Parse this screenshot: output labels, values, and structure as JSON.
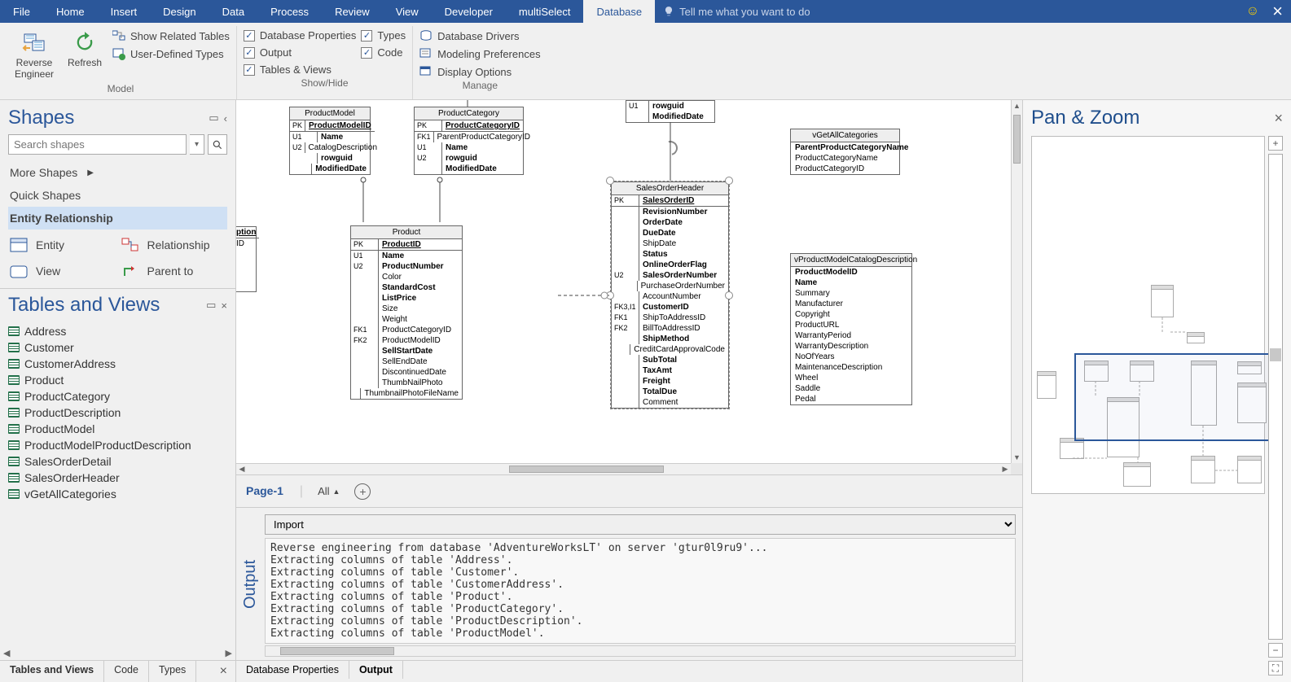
{
  "menubar": {
    "tabs": [
      "File",
      "Home",
      "Insert",
      "Design",
      "Data",
      "Process",
      "Review",
      "View",
      "Developer",
      "multiSelect",
      "Database"
    ],
    "active": "Database",
    "tellme": "Tell me what you want to do"
  },
  "ribbon": {
    "model": {
      "caption": "Model",
      "reverse": "Reverse Engineer",
      "refresh": "Refresh",
      "showrel": "Show Related Tables",
      "udt": "User-Defined Types"
    },
    "showhide": {
      "caption": "Show/Hide",
      "dbprops": "Database Properties",
      "output": "Output",
      "tviews": "Tables & Views",
      "types": "Types",
      "code": "Code"
    },
    "manage": {
      "caption": "Manage",
      "drivers": "Database Drivers",
      "prefs": "Modeling Preferences",
      "display": "Display Options"
    }
  },
  "shapes": {
    "title": "Shapes",
    "search_ph": "Search shapes",
    "more": "More Shapes",
    "quick": "Quick Shapes",
    "er": "Entity Relationship",
    "items": {
      "entity": "Entity",
      "relationship": "Relationship",
      "view": "View",
      "parent": "Parent to"
    }
  },
  "tables_views": {
    "title": "Tables and Views",
    "items": [
      "Address",
      "Customer",
      "CustomerAddress",
      "Product",
      "ProductCategory",
      "ProductDescription",
      "ProductModel",
      "ProductModelProductDescription",
      "SalesOrderDetail",
      "SalesOrderHeader",
      "vGetAllCategories"
    ],
    "tabs": [
      "Tables and Views",
      "Code",
      "Types"
    ],
    "active_tab": "Tables and Views"
  },
  "canvas": {
    "page": "Page-1",
    "all": "All",
    "partial": {
      "t1": "ption",
      "t2": "ID"
    },
    "topright": {
      "keys": "U1",
      "f1": "rowguid",
      "f2": "ModifiedDate"
    },
    "product_model": {
      "title": "ProductModel",
      "pk": "PK",
      "pkf": "ProductModelID",
      "u1": "U1",
      "u2": "U2",
      "rows": [
        "Name",
        "CatalogDescription",
        "rowguid",
        "ModifiedDate"
      ]
    },
    "product_category": {
      "title": "ProductCategory",
      "pk": "PK",
      "pkf": "ProductCategoryID",
      "k": [
        "FK1",
        "U1",
        "U2"
      ],
      "rows": [
        "ParentProductCategoryID",
        "Name",
        "rowguid",
        "ModifiedDate"
      ]
    },
    "product": {
      "title": "Product",
      "pk": "PK",
      "pkf": "ProductID",
      "k": [
        "U1",
        "U2",
        "",
        "",
        "",
        "",
        "",
        "FK1",
        "FK2",
        "",
        "",
        "",
        "",
        ""
      ],
      "rows": [
        "Name",
        "ProductNumber",
        "Color",
        "StandardCost",
        "ListPrice",
        "Size",
        "Weight",
        "ProductCategoryID",
        "ProductModelID",
        "SellStartDate",
        "SellEndDate",
        "DiscontinuedDate",
        "ThumbNailPhoto",
        "ThumbnailPhotoFileName"
      ],
      "bold": [
        0,
        1,
        3,
        4,
        9
      ]
    },
    "soh": {
      "title": "SalesOrderHeader",
      "pk": "PK",
      "pkf": "SalesOrderID",
      "k": [
        "",
        "",
        "",
        "",
        "",
        "",
        "U2",
        "",
        "",
        "FK3,I1",
        "FK1",
        "FK2",
        "",
        "",
        "",
        "",
        "",
        ""
      ],
      "rows": [
        "RevisionNumber",
        "OrderDate",
        "DueDate",
        "ShipDate",
        "Status",
        "OnlineOrderFlag",
        "SalesOrderNumber",
        "PurchaseOrderNumber",
        "AccountNumber",
        "CustomerID",
        "ShipToAddressID",
        "BillToAddressID",
        "ShipMethod",
        "CreditCardApprovalCode",
        "SubTotal",
        "TaxAmt",
        "Freight",
        "TotalDue",
        "Comment"
      ],
      "bold": [
        0,
        1,
        2,
        4,
        5,
        6,
        9,
        12,
        14,
        15,
        16,
        17
      ]
    },
    "vcat": {
      "title": "vGetAllCategories",
      "rows": [
        "ParentProductCategoryName",
        "ProductCategoryName",
        "ProductCategoryID"
      ],
      "bold": [
        0
      ]
    },
    "vprod": {
      "title": "vProductModelCatalogDescription",
      "rows": [
        "ProductModelID",
        "Name",
        "Summary",
        "Manufacturer",
        "Copyright",
        "ProductURL",
        "WarrantyPeriod",
        "WarrantyDescription",
        "NoOfYears",
        "MaintenanceDescription",
        "Wheel",
        "Saddle",
        "Pedal"
      ],
      "bold": [
        0,
        1
      ]
    }
  },
  "output": {
    "title": "Output",
    "filter": "Import",
    "lines": [
      "Reverse engineering from database 'AdventureWorksLT' on server 'gtur0l9ru9'...",
      "Extracting columns of table 'Address'.",
      "Extracting columns of table 'Customer'.",
      "Extracting columns of table 'CustomerAddress'.",
      "Extracting columns of table 'Product'.",
      "Extracting columns of table 'ProductCategory'.",
      "Extracting columns of table 'ProductDescription'.",
      "Extracting columns of table 'ProductModel'."
    ],
    "tabs": [
      "Database Properties",
      "Output"
    ],
    "active_tab": "Output"
  },
  "panzoom": {
    "title": "Pan & Zoom"
  }
}
